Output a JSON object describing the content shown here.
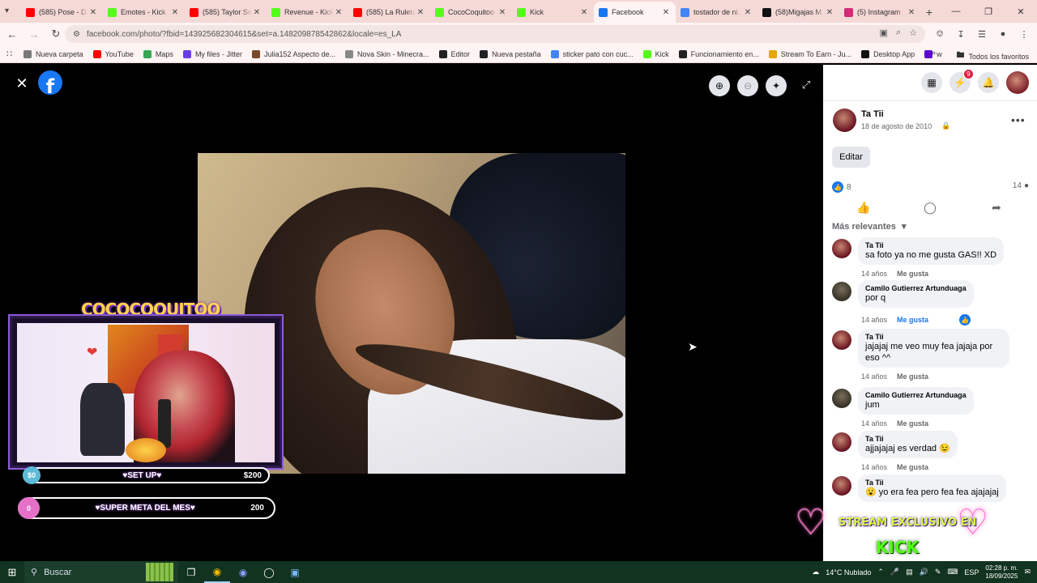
{
  "tabs": [
    {
      "title": "(585) Pose - D...",
      "icon": "youtube-icon",
      "color": "#ff0000"
    },
    {
      "title": "Emotes - Kick",
      "icon": "kick-icon",
      "color": "#53fc18"
    },
    {
      "title": "(585) Taylor Sw...",
      "icon": "youtube-icon",
      "color": "#ff0000"
    },
    {
      "title": "Revenue - Kick",
      "icon": "kick-icon",
      "color": "#53fc18"
    },
    {
      "title": "(585) La Ruleta",
      "icon": "youtube-icon",
      "color": "#ff0000"
    },
    {
      "title": "CocoCoquitoo",
      "icon": "kick-icon",
      "color": "#53fc18"
    },
    {
      "title": "Kick",
      "icon": "kick-icon",
      "color": "#53fc18"
    },
    {
      "title": "Facebook",
      "icon": "facebook-icon",
      "color": "#1877f2",
      "active": true
    },
    {
      "title": "tostador de ni...",
      "icon": "google-icon",
      "color": "#4285f4"
    },
    {
      "title": "(58)Migajas M...",
      "icon": "tiktok-icon",
      "color": "#111111"
    },
    {
      "title": "(5) Instagram",
      "icon": "instagram-icon",
      "color": "#d62976"
    }
  ],
  "address": {
    "url": "facebook.com/photo/?fbid=143925682304615&set=a.148209878542862&locale=es_LA"
  },
  "bookmarks": [
    {
      "label": "Nueva carpeta",
      "icon": "folder-icon",
      "color": "#777777"
    },
    {
      "label": "YouTube",
      "icon": "youtube-icon",
      "color": "#ff0000"
    },
    {
      "label": "Maps",
      "icon": "maps-icon",
      "color": "#34a853"
    },
    {
      "label": "My files - Jitter",
      "icon": "jitter-icon",
      "color": "#6a3de8"
    },
    {
      "label": "Julia152 Aspecto de...",
      "icon": "minecraft-icon",
      "color": "#7a4a2a"
    },
    {
      "label": "Nova Skin - Minecra...",
      "icon": "cube-icon",
      "color": "#888888"
    },
    {
      "label": "Editor",
      "icon": "editor-icon",
      "color": "#222222"
    },
    {
      "label": "Nueva pestaña",
      "icon": "newtab-icon",
      "color": "#222222"
    },
    {
      "label": "sticker pato con cuc...",
      "icon": "google-icon",
      "color": "#4285f4"
    },
    {
      "label": "Kick",
      "icon": "kick-icon",
      "color": "#53fc18"
    },
    {
      "label": "Funcionamiento en...",
      "icon": "github-icon",
      "color": "#222222"
    },
    {
      "label": "Stream To Earn - Ju...",
      "icon": "coin-icon",
      "color": "#e6a700"
    },
    {
      "label": "Desktop App",
      "icon": "tiktok-icon",
      "color": "#111111"
    },
    {
      "label": "w",
      "icon": "yahoo-icon",
      "color": "#6001d2"
    }
  ],
  "bookmarks_all": "Todos los favoritos",
  "viewer": {
    "logo": "f"
  },
  "overlay": {
    "title": "COCOCOQUITOO",
    "bar1": {
      "start": "$0",
      "label": "♥SET UP♥",
      "end": "$200",
      "color": "#5dbad8"
    },
    "bar2": {
      "start": "0",
      "label": "♥SUPER META DEL MES♥",
      "end": "200",
      "color": "#e470c8"
    },
    "kick_line1": "STREAM EXCLUSIVO EN",
    "kick_line2": "KICK"
  },
  "panel": {
    "messenger_badge": "9",
    "author": "Ta Tii",
    "date": "18 de agosto de 2010",
    "edit_label": "Editar",
    "likes": "8",
    "comments_count": "14",
    "sort_label": "Más relevantes",
    "comments": [
      {
        "author": "Ta Tii",
        "text": "sa foto ya no me gusta GAS!! XD",
        "time": "14 años",
        "like": "Me gusta",
        "avatar": "tatii"
      },
      {
        "author": "Camilo Gutierrez Artunduaga",
        "text": "por q",
        "time": "14 años",
        "like": "Me gusta",
        "avatar": "camilo",
        "liked": true
      },
      {
        "author": "Ta Tii",
        "text": "jajajaj me veo muy fea jajaja por eso ^^",
        "time": "14 años",
        "like": "Me gusta",
        "avatar": "tatii"
      },
      {
        "author": "Camilo Gutierrez Artunduaga",
        "text": "jum",
        "time": "14 años",
        "like": "Me gusta",
        "avatar": "camilo"
      },
      {
        "author": "Ta Tii",
        "text": "ajjajajaj es verdad 😉",
        "time": "14 años",
        "like": "Me gusta",
        "avatar": "tatii"
      },
      {
        "author": "Ta Tii",
        "text": "😮 yo era fea pero fea fea ajajajaj",
        "time": "",
        "like": "",
        "avatar": "tatii"
      }
    ]
  },
  "taskbar": {
    "search_label": "Buscar",
    "weather": "14°C  Nublado",
    "lang": "ESP",
    "time": "02:28 p. m.",
    "date": "18/09/2025"
  }
}
